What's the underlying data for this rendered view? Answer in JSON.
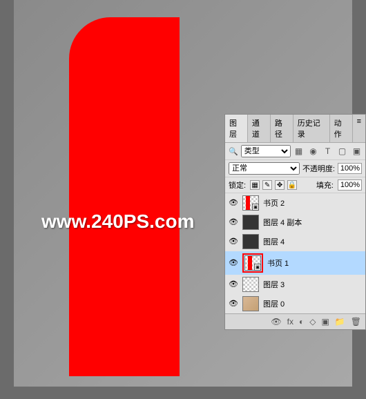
{
  "watermark": "www.240PS.com",
  "panel": {
    "tabs": [
      "图层",
      "通道",
      "路径",
      "历史记录",
      "动作"
    ],
    "active_tab": 0,
    "type_selector": {
      "icon": "🔍",
      "label": "类型"
    },
    "type_icons": [
      "▦",
      "◉",
      "T",
      "▢",
      "▣"
    ],
    "blend_mode": "正常",
    "opacity_label": "不透明度:",
    "opacity_value": "100%",
    "lock_label": "锁定:",
    "fill_label": "填充:",
    "fill_value": "100%",
    "layers": [
      {
        "name": "书页 2",
        "selected": false,
        "smart": true,
        "thumb": "checker-red"
      },
      {
        "name": "图层 4 副本",
        "selected": false,
        "smart": false,
        "thumb": "dark"
      },
      {
        "name": "图层 4",
        "selected": false,
        "smart": false,
        "thumb": "dark"
      },
      {
        "name": "书页 1",
        "selected": true,
        "smart": true,
        "thumb": "checker-red",
        "highlighted": true
      },
      {
        "name": "图层 3",
        "selected": false,
        "smart": false,
        "thumb": "checker"
      },
      {
        "name": "图层 0",
        "selected": false,
        "smart": false,
        "thumb": "face"
      }
    ],
    "bottom_icons": [
      "👁",
      "fx",
      "◐",
      "◇",
      "▣",
      "📁",
      "🗑"
    ]
  }
}
